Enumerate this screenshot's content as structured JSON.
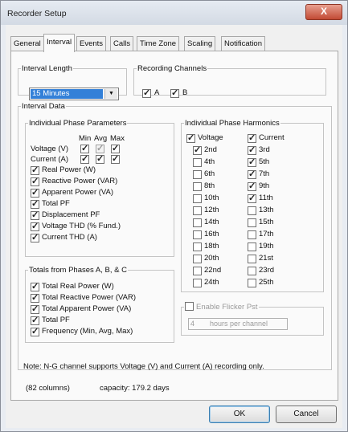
{
  "window": {
    "title": "Recorder Setup",
    "close_label": "X"
  },
  "tabs": [
    "General",
    "Interval",
    "Events",
    "Calls",
    "Time Zone",
    "Scaling",
    "Notification"
  ],
  "interval_length": {
    "legend": "Interval Length",
    "selected": "15 Minutes"
  },
  "recording_channels": {
    "legend": "Recording Channels",
    "a_label": "A",
    "b_label": "B",
    "a_checked": true,
    "b_checked": true
  },
  "interval_data": {
    "legend": "Interval Data"
  },
  "phase_params": {
    "legend": "Individual Phase Parameters",
    "col_min": "Min",
    "col_avg": "Avg",
    "col_max": "Max",
    "voltage_label": "Voltage (V)",
    "current_label": "Current (A)",
    "items": [
      "Real Power (W)",
      "Reactive Power (VAR)",
      "Apparent Power (VA)",
      "Total PF",
      "Displacement PF",
      "Voltage THD (% Fund.)",
      "Current THD (A)"
    ]
  },
  "totals": {
    "legend": "Totals from Phases A, B, & C",
    "items": [
      "Total Real Power (W)",
      "Total Reactive Power (VAR)",
      "Total Apparent Power (VA)",
      "Total PF",
      "Frequency (Min, Avg, Max)"
    ]
  },
  "harmonics": {
    "legend": "Individual Phase Harmonics",
    "voltage_label": "Voltage",
    "current_label": "Current",
    "voltage_items": [
      "2nd",
      "4th",
      "6th",
      "8th",
      "10th",
      "12th",
      "14th",
      "16th",
      "18th",
      "20th",
      "22nd",
      "24th"
    ],
    "current_items": [
      "3rd",
      "5th",
      "7th",
      "9th",
      "11th",
      "13th",
      "15th",
      "17th",
      "19th",
      "21st",
      "23rd",
      "25th"
    ]
  },
  "flicker": {
    "label": "Enable Flicker Pst",
    "value": "4",
    "unit": "hours per channel"
  },
  "note": "Note: N-G channel supports Voltage (V) and Current (A) recording only.",
  "summary": {
    "columns": "(82 columns)",
    "capacity": "capacity: 179.2 days"
  },
  "buttons": {
    "ok": "OK",
    "cancel": "Cancel"
  }
}
